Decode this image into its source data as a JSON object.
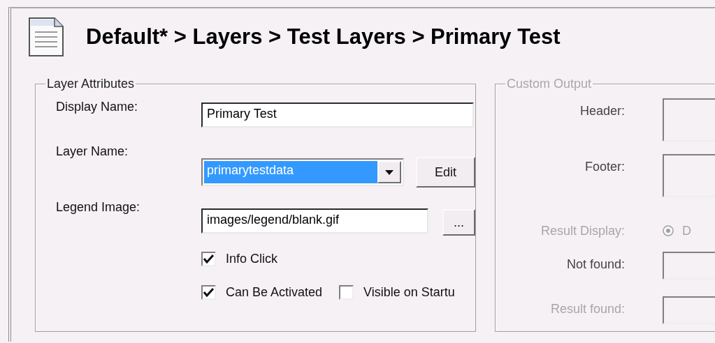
{
  "title": "Default* > Layers > Test Layers > Primary Test",
  "layer_attributes": {
    "legend": "Layer Attributes",
    "display_name": {
      "label": "Display Name:",
      "value": "Primary Test"
    },
    "layer_name": {
      "label": "Layer Name:",
      "value": "primarytestdata",
      "selected": true,
      "button": "Edit"
    },
    "legend_image": {
      "label": "Legend Image:",
      "value": "images/legend/blank.gif",
      "button": "..."
    },
    "checkbox_rows": [
      [
        {
          "label": "Info Click",
          "checked": true
        }
      ],
      [
        {
          "label": "Can Be Activated",
          "checked": true
        },
        {
          "label": "Visible on Startu",
          "checked": false
        }
      ]
    ]
  },
  "custom_output": {
    "legend": "Custom Output",
    "disabled": true,
    "rows": [
      {
        "kind": "textarea",
        "label": "Header:",
        "disabled": false
      },
      {
        "kind": "textarea",
        "label": "Footer:",
        "disabled": false
      },
      {
        "kind": "radio",
        "label": "Result Display:",
        "option": "D",
        "selected": true,
        "disabled": true
      },
      {
        "kind": "field",
        "label": "Not found:",
        "disabled": false
      },
      {
        "kind": "field",
        "label": "Result found:",
        "disabled": true
      }
    ]
  }
}
